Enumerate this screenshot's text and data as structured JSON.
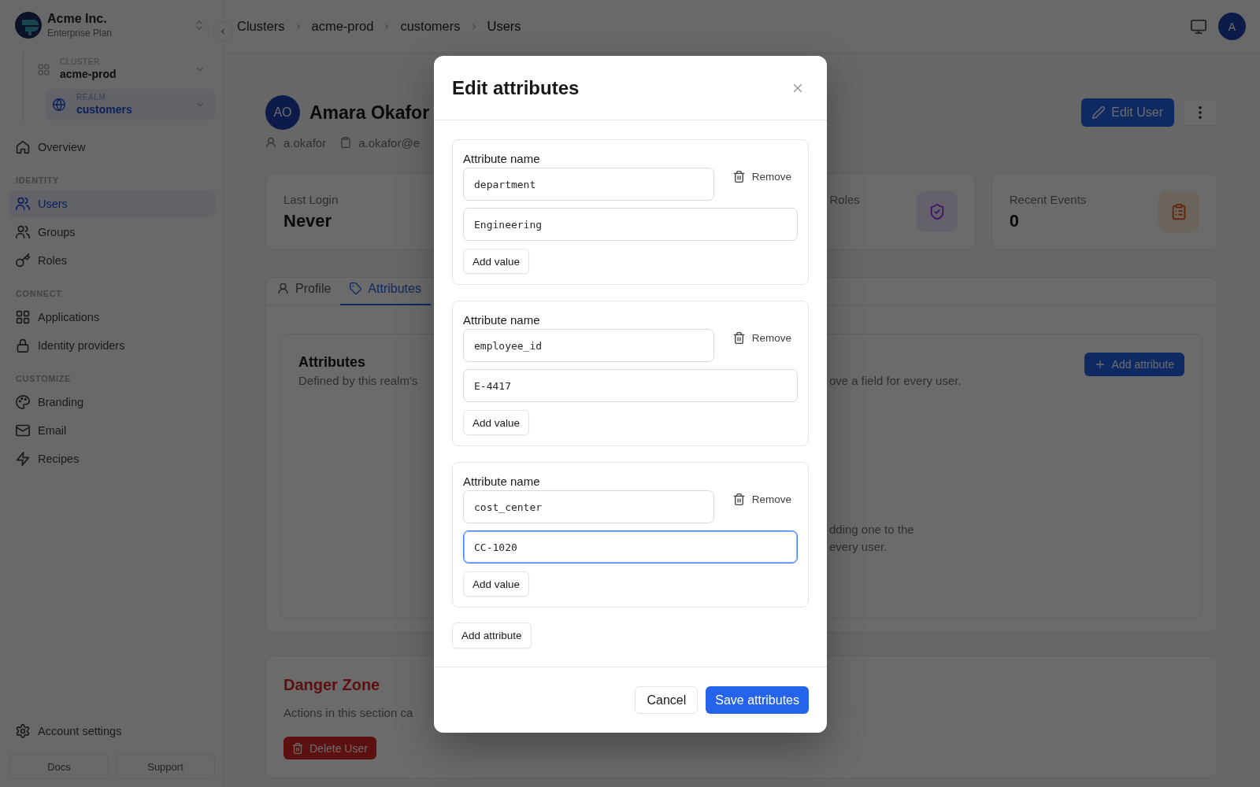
{
  "sidebar": {
    "org": {
      "name": "Acme Inc.",
      "plan": "Enterprise Plan"
    },
    "scope": [
      {
        "label": "CLUSTER",
        "value": "acme-prod",
        "selected": false,
        "children": [
          {
            "label": "REALM",
            "value": "customers",
            "selected": true
          }
        ]
      }
    ],
    "sections": [
      {
        "items": [
          {
            "label": "Overview",
            "selected": false
          }
        ]
      },
      {
        "title": "IDENTITY",
        "items": [
          {
            "label": "Users",
            "selected": true
          },
          {
            "label": "Groups",
            "selected": false
          },
          {
            "label": "Roles",
            "selected": false
          }
        ]
      },
      {
        "title": "CONNECT",
        "items": [
          {
            "label": "Applications",
            "selected": false
          },
          {
            "label": "Identity providers",
            "selected": false
          }
        ]
      },
      {
        "title": "CUSTOMIZE",
        "items": [
          {
            "label": "Branding",
            "selected": false
          },
          {
            "label": "Email",
            "selected": false
          },
          {
            "label": "Recipes",
            "selected": false
          }
        ]
      }
    ],
    "account_settings": "Account settings",
    "footer_links": [
      "Docs",
      "Support"
    ]
  },
  "header": {
    "breadcrumb": [
      "Clusters",
      "acme-prod",
      "customers",
      "Users"
    ],
    "avatar": "A"
  },
  "user": {
    "initials": "AO",
    "name": "Amara Okafor",
    "username": "a.okafor",
    "email": "a.okafor@e",
    "edit_button": "Edit User"
  },
  "stats": [
    {
      "label": "Last Login",
      "value": "Never"
    },
    {
      "label": "Roles"
    },
    {
      "label": "Recent Events",
      "value": "0"
    }
  ],
  "tabs": [
    {
      "label": "Profile",
      "selected": false
    },
    {
      "label": "Attributes",
      "selected": true
    }
  ],
  "attributes_panel": {
    "title": "Attributes",
    "description_left": "Defined by this realm's",
    "description_right": "ove a field for every user.",
    "add_button": "Add attribute",
    "empty_state_lines": [
      "dding one to the",
      "every user."
    ]
  },
  "danger_zone": {
    "title": "Danger Zone",
    "description": "Actions in this section ca",
    "button": "Delete User"
  },
  "dialog": {
    "title": "Edit attributes",
    "attributes": [
      {
        "label": "Attribute name",
        "name": "department",
        "remove": "Remove",
        "values": [
          {
            "value": "Engineering",
            "focused": false
          }
        ],
        "add_value": "Add value"
      },
      {
        "label": "Attribute name",
        "name": "employee_id",
        "remove": "Remove",
        "values": [
          {
            "value": "E-4417",
            "focused": false
          }
        ],
        "add_value": "Add value"
      },
      {
        "label": "Attribute name",
        "name": "cost_center",
        "remove": "Remove",
        "values": [
          {
            "value": "CC-1020",
            "focused": true
          }
        ],
        "add_value": "Add value"
      }
    ],
    "add_attribute": "Add attribute",
    "cancel": "Cancel",
    "save": "Save attributes"
  }
}
